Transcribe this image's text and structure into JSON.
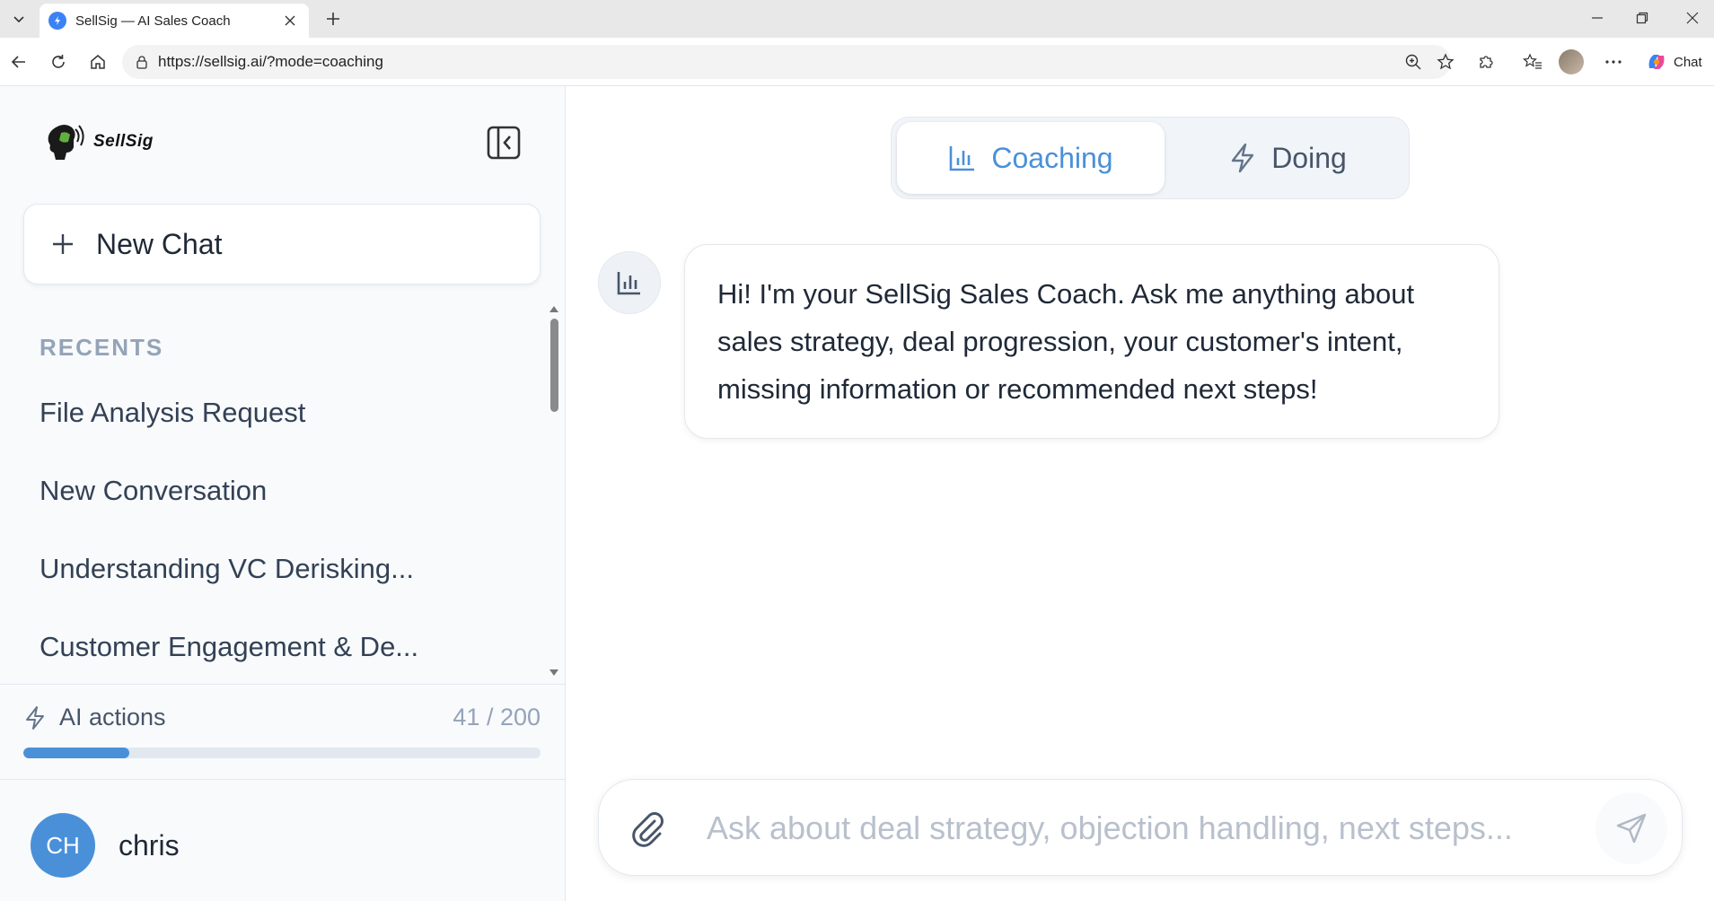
{
  "browser": {
    "tab_title": "SellSig — AI Sales Coach",
    "url": "https://sellsig.ai/?mode=coaching",
    "chat_label": "Chat"
  },
  "sidebar": {
    "logo_text": "SellSig",
    "new_chat_label": "New Chat",
    "recents_label": "RECENTS",
    "recents": [
      "File Analysis Request",
      "New Conversation",
      "Understanding VC Derisking...",
      "Customer Engagement & De..."
    ],
    "ai_actions": {
      "label": "AI actions",
      "count_text": "41 / 200",
      "used": 41,
      "total": 200
    },
    "user": {
      "initials": "CH",
      "name": "chris"
    }
  },
  "main": {
    "modes": {
      "coaching": "Coaching",
      "doing": "Doing",
      "active": "coaching"
    },
    "messages": [
      {
        "role": "assistant",
        "text": "Hi! I'm your SellSig Sales Coach. Ask me anything about sales strategy, deal progression, your customer's intent, missing information or recommended next steps!"
      }
    ],
    "composer": {
      "placeholder": "Ask about deal strategy, objection handling, next steps..."
    }
  },
  "colors": {
    "accent": "#4a90d9",
    "text": "#1f2937",
    "muted": "#94a3b8"
  }
}
